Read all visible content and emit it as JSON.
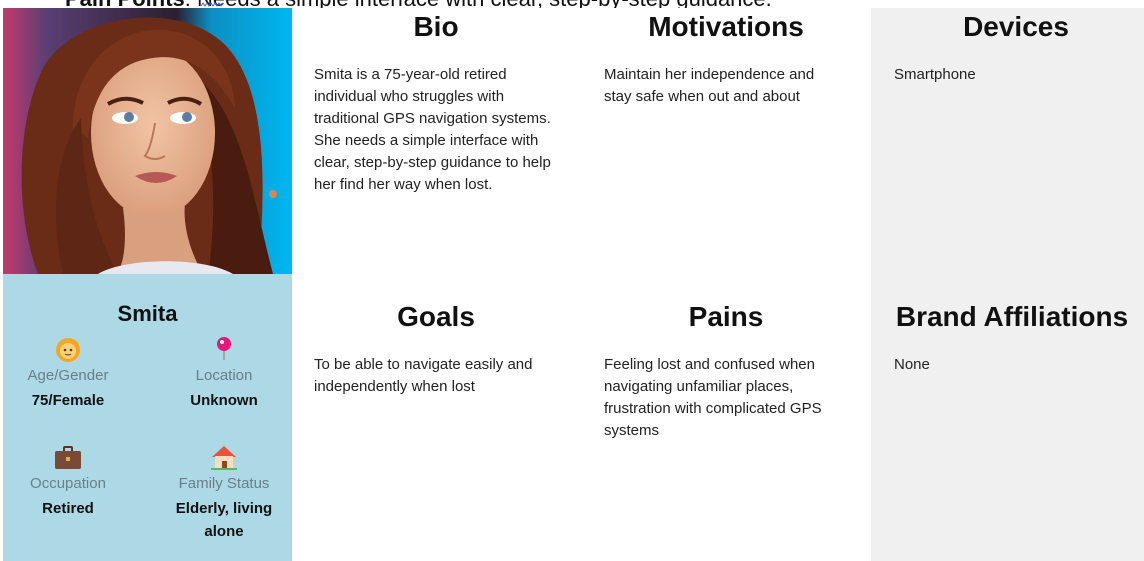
{
  "top_strip": {
    "bold_text": "Pain Points",
    "rest_text": ": Needs a simple interface with clear, step-by-step guidance."
  },
  "persona": {
    "name": "Smita",
    "stats": [
      {
        "icon": "person-icon",
        "label": "Age/Gender",
        "value": "75/Female"
      },
      {
        "icon": "location-pin-icon",
        "label": "Location",
        "value": "Unknown"
      },
      {
        "icon": "briefcase-icon",
        "label": "Occupation",
        "value": "Retired"
      },
      {
        "icon": "house-icon",
        "label": "Family Status",
        "value": "Elderly, living alone"
      }
    ]
  },
  "sections": {
    "bio": {
      "title": "Bio",
      "text": "Smita is a 75-year-old retired individual who struggles with traditional GPS navigation systems. She needs a simple interface with clear, step-by-step guidance to help her find her way when lost."
    },
    "motivations": {
      "title": "Motivations",
      "text": "Maintain her independence and stay safe when out and about"
    },
    "devices": {
      "title": "Devices",
      "text": "Smartphone"
    },
    "goals": {
      "title": "Goals",
      "text": "To be able to navigate easily and independently when lost"
    },
    "pains": {
      "title": "Pains",
      "text": "Feeling lost and confused when navigating unfamiliar places, frustration with complicated GPS systems"
    },
    "brand_affiliations": {
      "title": "Brand Affiliations",
      "text": "None"
    }
  },
  "colors": {
    "left_panel": "#add8e6",
    "devices_panel": "#f0f0f0"
  }
}
